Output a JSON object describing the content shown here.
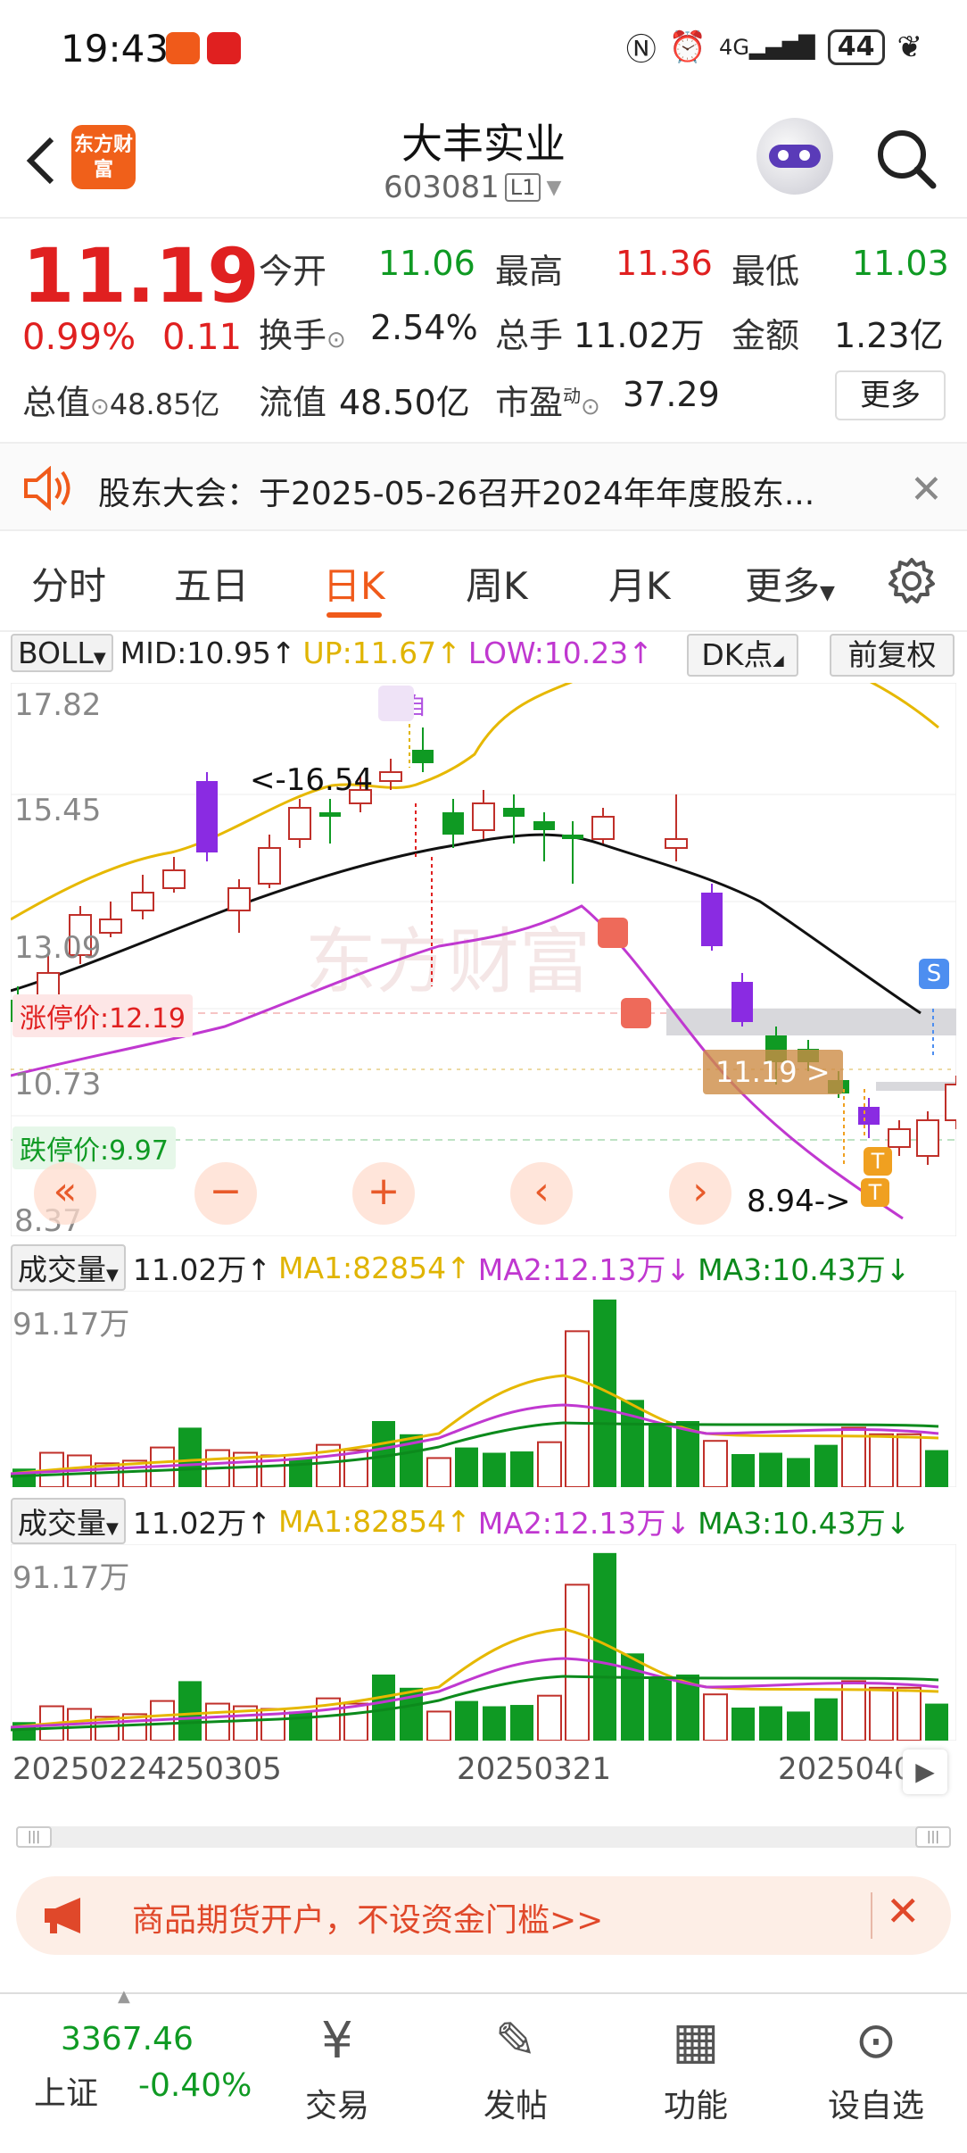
{
  "status_bar": {
    "time": "19:43",
    "signal": "4G",
    "battery": "44"
  },
  "header": {
    "logo_text": "东方财富",
    "stock_name": "大丰实业",
    "stock_code": "603081",
    "level": "L1"
  },
  "quote": {
    "price": "11.19",
    "pct": "0.99%",
    "change": "0.11",
    "market_cap_label": "总值",
    "market_cap": "48.85亿",
    "open_label": "今开",
    "open": "11.06",
    "high_label": "最高",
    "high": "11.36",
    "low_label": "最低",
    "low": "11.03",
    "turnover_label": "换手",
    "turnover": "2.54%",
    "volume_label": "总手",
    "volume": "11.02万",
    "amount_label": "金额",
    "amount": "1.23亿",
    "float_label": "流值",
    "float_cap": "48.50亿",
    "pe_label": "市盈",
    "pe_sup": "动",
    "pe": "37.29",
    "more_label": "更多"
  },
  "announcement": {
    "text": "股东大会：于2025-05-26召开2024年年度股东..."
  },
  "tabs": [
    "分时",
    "五日",
    "日K",
    "周K",
    "月K",
    "更多"
  ],
  "active_tab": "日K",
  "boll": {
    "label": "BOLL",
    "mid": "MID:10.95↑",
    "up": "UP:11.67↑",
    "low": "LOW:10.23↑",
    "dk": "DK点",
    "fq": "前复权"
  },
  "chart": {
    "y_labels": [
      "17.82",
      "15.45",
      "13.09",
      "10.73",
      "8.37"
    ],
    "limit_up": "涨停价:12.19",
    "limit_down": "跌停价:9.97",
    "high_mark": "<-16.54",
    "low_mark": "8.94->",
    "current_tag": "11.19 >",
    "signal_self": "自",
    "signal_b": "B",
    "signal_s": "S",
    "signal_t": "T",
    "watermark": "东方财富"
  },
  "vol1": {
    "label": "成交量",
    "value": "11.02万↑",
    "ma1": "MA1:82854↑",
    "ma2": "MA2:12.13万↓",
    "ma3": "MA3:10.43万↓",
    "max": "91.17万"
  },
  "vol2": {
    "label": "成交量",
    "value": "11.02万↑",
    "ma1": "MA1:82854↑",
    "ma2": "MA2:12.13万↓",
    "ma3": "MA3:10.43万↓",
    "max": "91.17万"
  },
  "dates": [
    "20250224",
    "250305",
    "20250321",
    "2025040"
  ],
  "ad": {
    "text": "商品期货开户，不设资金门槛>>"
  },
  "bottom_nav": {
    "index_value": "3367.46",
    "index_name": "上证",
    "index_change": "-0.40%",
    "items": [
      "交易",
      "发帖",
      "功能",
      "设自选"
    ]
  },
  "colors": {
    "up": "#e02020",
    "down": "#0f9a23",
    "accent": "#f05a1a",
    "boll_up": "#e6b800",
    "boll_low": "#c038d0",
    "candle_purple": "#8a2be2"
  }
}
